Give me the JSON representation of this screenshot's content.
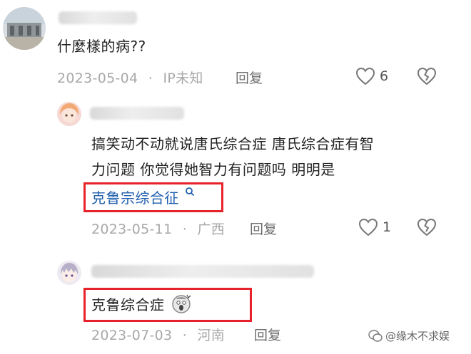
{
  "comments": [
    {
      "text": "什麼樣的病??",
      "date": "2023-05-04",
      "location": "IP未知",
      "reply_label": "回复",
      "likes": "6"
    },
    {
      "text_line1": "搞笑动不动就说唐氏综合症 唐氏综合症有智",
      "text_line2": "力问题 你觉得她智力有问题吗 明明是",
      "link": "克鲁宗综合征",
      "date": "2023-05-11",
      "location": "广西",
      "reply_label": "回复",
      "likes": "1"
    },
    {
      "text": "克鲁综合症",
      "emoji": "face-scream-emoji",
      "date": "2023-07-03",
      "location": "河南",
      "reply_label": "回复"
    }
  ],
  "separator": "·",
  "watermark": "@缘木不求娱",
  "colors": {
    "link": "#1f5fae",
    "highlight_box": "#e8222a",
    "meta": "#a8a8a8"
  }
}
